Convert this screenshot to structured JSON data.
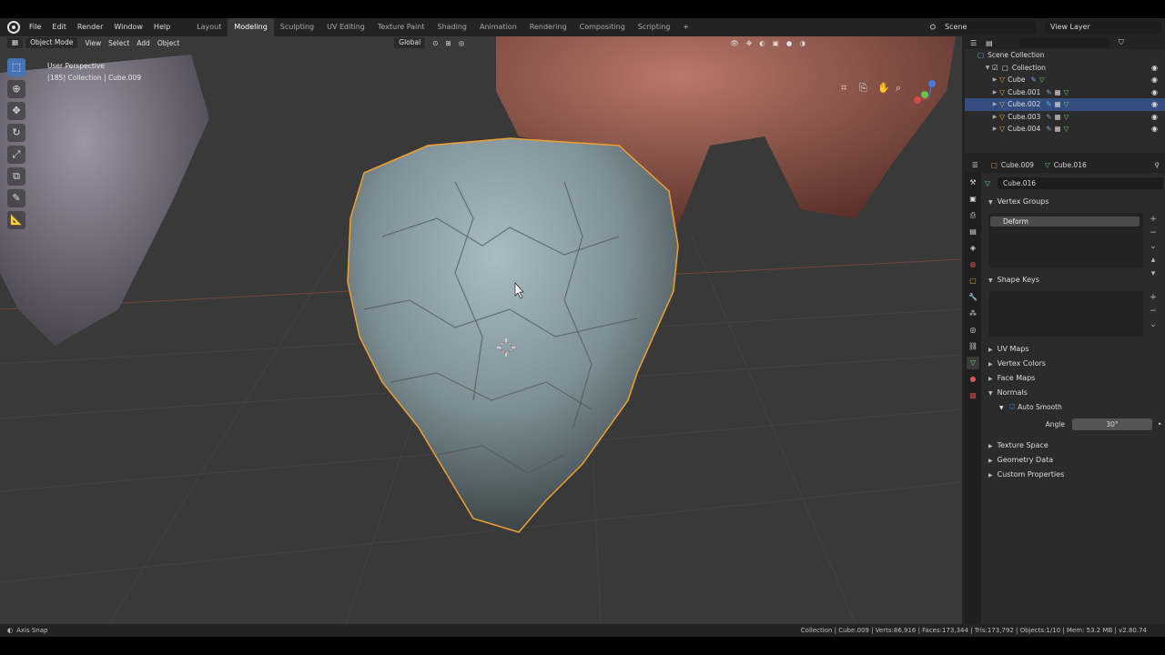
{
  "menu": [
    "File",
    "Edit",
    "Render",
    "Window",
    "Help"
  ],
  "workspaces": [
    {
      "label": "Layout",
      "active": false
    },
    {
      "label": "Modeling",
      "active": true
    },
    {
      "label": "Sculpting",
      "active": false
    },
    {
      "label": "UV Editing",
      "active": false
    },
    {
      "label": "Texture Paint",
      "active": false
    },
    {
      "label": "Shading",
      "active": false
    },
    {
      "label": "Animation",
      "active": false
    },
    {
      "label": "Rendering",
      "active": false
    },
    {
      "label": "Compositing",
      "active": false
    },
    {
      "label": "Scripting",
      "active": false
    }
  ],
  "workspace_add": "+",
  "scene": "Scene",
  "view_layer": "View Layer",
  "viewport": {
    "mode": "Object Mode",
    "menus": [
      "View",
      "Select",
      "Add",
      "Object"
    ],
    "orientation": "Global",
    "perspective": "User Perspective",
    "collection_info": "(185) Collection | Cube.009"
  },
  "outliner": {
    "rows": [
      {
        "label": "Scene Collection",
        "selected": false
      },
      {
        "label": "Collection",
        "selected": false
      },
      {
        "label": "Cube",
        "selected": false
      },
      {
        "label": "Cube.001",
        "selected": false
      },
      {
        "label": "Cube.002",
        "selected": true
      },
      {
        "label": "Cube.003",
        "selected": false
      },
      {
        "label": "Cube.004",
        "selected": false
      }
    ]
  },
  "properties": {
    "object_name": "Cube.009",
    "mesh_name": "Cube.016",
    "data_field": "Cube.016",
    "vertex_groups_label": "Vertex Groups",
    "vertex_group_item": "Deform",
    "shape_keys_label": "Shape Keys",
    "panels": [
      "UV Maps",
      "Vertex Colors",
      "Face Maps",
      "Normals"
    ],
    "auto_smooth_label": "Auto Smooth",
    "angle_label": "Angle",
    "angle_value": "30°",
    "panels_bottom": [
      "Texture Space",
      "Geometry Data",
      "Custom Properties"
    ]
  },
  "colors": {
    "accent": "#4772b3",
    "selection": "#334d80",
    "outline": "#f0a030"
  },
  "status": {
    "left": "Axis Snap",
    "right": "Collection | Cube.009 | Verts:86,916 | Faces:173,344 | Tris:173,792 | Objects:1/10 | Mem: 53.2 MB | v2.80.74"
  }
}
